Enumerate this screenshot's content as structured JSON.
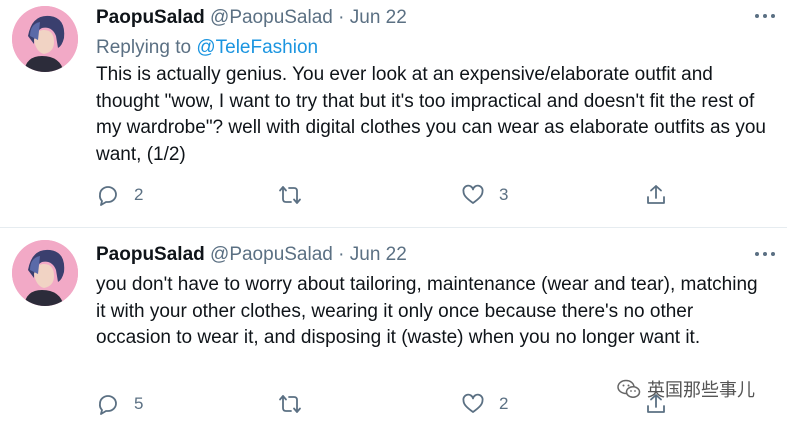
{
  "tweets": [
    {
      "author_name": "PaopuSalad",
      "handle": "@PaopuSalad",
      "separator": "·",
      "date": "Jun 22",
      "replying_to_label": "Replying to",
      "replying_to_handle": "@TeleFashion",
      "text": "This is actually genius. You ever look at an expensive/elaborate outfit and thought \"wow, I want to try that but it's too impractical and doesn't fit the rest of my wardrobe\"? well with digital clothes you can wear as elaborate outfits as you want, (1/2)",
      "reply_count": "2",
      "like_count": "3"
    },
    {
      "author_name": "PaopuSalad",
      "handle": "@PaopuSalad",
      "separator": "·",
      "date": "Jun 22",
      "text": "you don't have to worry about tailoring, maintenance (wear and tear), matching it with your other clothes, wearing it only once because there's no other occasion to wear it, and disposing it (waste) when you no longer want it.",
      "reply_count": "5",
      "like_count": "2"
    }
  ],
  "watermark": {
    "text": "英国那些事儿",
    "icon": "wechat-icon"
  },
  "icons": {
    "reply": "reply-icon",
    "retweet": "retweet-icon",
    "like": "heart-icon",
    "share": "share-icon",
    "more": "more-icon"
  },
  "colors": {
    "secondary_text": "#5b7083",
    "link": "#1b95e0",
    "divider": "#e6ecf0"
  }
}
